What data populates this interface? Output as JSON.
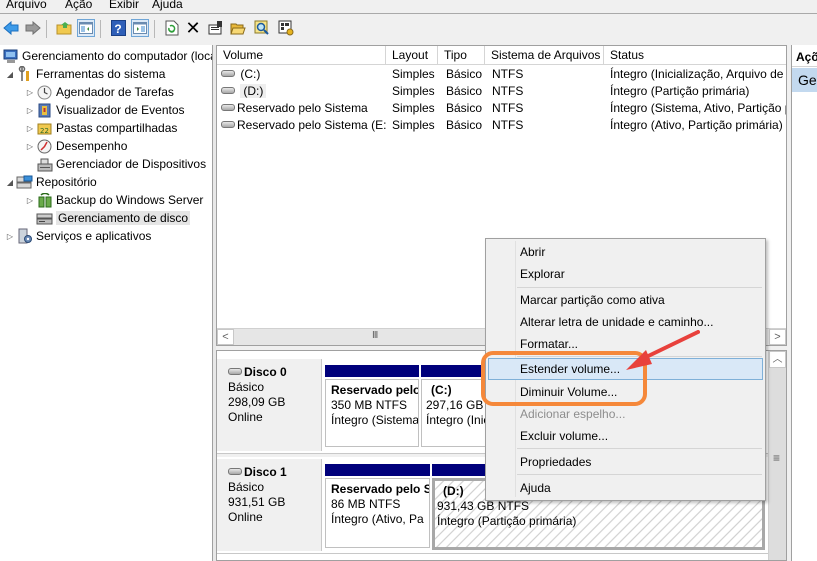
{
  "menubar": {
    "items": [
      "Arquivo",
      "Ação",
      "Exibir",
      "Ajuda"
    ]
  },
  "toolbar": {
    "buttons": [
      {
        "icon": "back-arrow-icon"
      },
      {
        "icon": "forward-arrow-icon"
      },
      {
        "icon": "up-folder-icon"
      },
      {
        "icon": "show-hide-console-tree-icon"
      },
      {
        "icon": "help-icon"
      },
      {
        "icon": "show-hide-action-pane-icon"
      },
      {
        "icon": "refresh-icon"
      },
      {
        "icon": "delete-icon"
      },
      {
        "icon": "properties-icon"
      },
      {
        "icon": "open-folder-icon"
      },
      {
        "icon": "search-icon"
      },
      {
        "icon": "settings-icon"
      }
    ]
  },
  "tree": {
    "items": [
      {
        "label": "Gerenciamento do computador (local)",
        "level": 0,
        "expander": "",
        "icon": "computer-management-icon"
      },
      {
        "label": "Ferramentas do sistema",
        "level": 1,
        "expander": "expanded",
        "icon": "system-tools-icon"
      },
      {
        "label": "Agendador de Tarefas",
        "level": 2,
        "expander": "collapsed",
        "icon": "clock-icon"
      },
      {
        "label": "Visualizador de Eventos",
        "level": 2,
        "expander": "collapsed",
        "icon": "event-viewer-icon"
      },
      {
        "label": "Pastas compartilhadas",
        "level": 2,
        "expander": "collapsed",
        "icon": "shared-folder-icon"
      },
      {
        "label": "Desempenho",
        "level": 2,
        "expander": "collapsed",
        "icon": "performance-icon"
      },
      {
        "label": "Gerenciador de Dispositivos",
        "level": 2,
        "expander": "",
        "icon": "device-manager-icon"
      },
      {
        "label": "Repositório",
        "level": 1,
        "expander": "expanded",
        "icon": "storage-icon"
      },
      {
        "label": "Backup do Windows Server",
        "level": 2,
        "expander": "collapsed",
        "icon": "backup-icon"
      },
      {
        "label": "Gerenciamento de disco",
        "level": 2,
        "expander": "",
        "icon": "disk-management-icon",
        "selected": true
      },
      {
        "label": "Serviços e aplicativos",
        "level": 1,
        "expander": "collapsed",
        "icon": "services-icon"
      }
    ]
  },
  "volumes": {
    "columns": [
      "Volume",
      "Layout",
      "Tipo",
      "Sistema de Arquivos",
      "Status"
    ],
    "rows": [
      {
        "volume": "(C:)",
        "layout": "Simples",
        "tipo": "Básico",
        "fs": "NTFS",
        "status": "Íntegro (Inicialização, Arquivo de"
      },
      {
        "volume": "(D:)",
        "layout": "Simples",
        "tipo": "Básico",
        "fs": "NTFS",
        "status": "Íntegro (Partição primária)"
      },
      {
        "volume": "Reservado pelo Sistema",
        "layout": "Simples",
        "tipo": "Básico",
        "fs": "NTFS",
        "status": "Íntegro (Sistema, Ativo, Partição p"
      },
      {
        "volume": "Reservado pelo Sistema (E:)",
        "layout": "Simples",
        "tipo": "Básico",
        "fs": "NTFS",
        "status": "Íntegro (Ativo, Partição primária)"
      }
    ],
    "scroll_left": "<",
    "scroll_right": ">",
    "scroll_grip": "III"
  },
  "disks": [
    {
      "name": "Disco 0",
      "type": "Básico",
      "size": "298,09 GB",
      "state": "Online",
      "partitions": [
        {
          "name": "Reservado pelo Sistema",
          "size": "350 MB NTFS",
          "status": "Íntegro (Sistema"
        },
        {
          "name": "(C:)",
          "size": "297,16 GB NTFS",
          "status": "Íntegro (Inicialização"
        }
      ]
    },
    {
      "name": "Disco 1",
      "type": "Básico",
      "size": "931,51 GB",
      "state": "Online",
      "partitions": [
        {
          "name": "Reservado pelo Sistema",
          "size": "86 MB NTFS",
          "status": "Íntegro (Ativo, Pa"
        },
        {
          "name": "(D:)",
          "size": "931,43 GB NTFS",
          "status": "Íntegro (Partição primária)",
          "selected": true
        }
      ]
    }
  ],
  "actions": {
    "header": "Ações",
    "item": "Gerenciamento de disco"
  },
  "context_menu": {
    "items": [
      {
        "label": "Abrir",
        "state": "normal"
      },
      {
        "label": "Explorar",
        "state": "normal"
      },
      {
        "separator": true
      },
      {
        "label": "Marcar partição como ativa",
        "state": "normal"
      },
      {
        "label": "Alterar letra de unidade e caminho...",
        "state": "normal"
      },
      {
        "label": "Formatar...",
        "state": "normal"
      },
      {
        "separator": true
      },
      {
        "label": "Estender volume...",
        "state": "hover"
      },
      {
        "label": "Diminuir Volume...",
        "state": "normal"
      },
      {
        "label": "Adicionar espelho...",
        "state": "disabled"
      },
      {
        "label": "Excluir volume...",
        "state": "normal"
      },
      {
        "separator": true
      },
      {
        "label": "Propriedades",
        "state": "normal"
      },
      {
        "separator": true
      },
      {
        "label": "Ajuda",
        "state": "normal"
      }
    ]
  },
  "annotation": {
    "ring_color": "#f5883a",
    "arrow_color": "#e8413c"
  }
}
